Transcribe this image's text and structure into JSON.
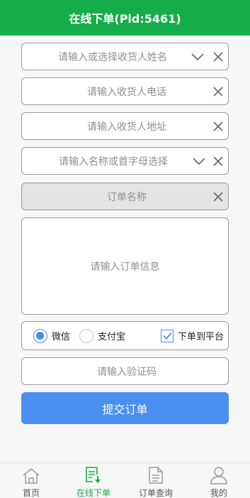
{
  "header": {
    "title": "在线下单(Pid:5461)"
  },
  "form": {
    "recipient_name_placeholder": "请输入或选择收货人姓名",
    "phone_placeholder": "请输入收货人电话",
    "address_placeholder": "请输入收货人地址",
    "product_placeholder": "请输入名称或首字母选择",
    "order_name_placeholder": "订单名称",
    "order_info_placeholder": "请输入订单信息",
    "payment_options": [
      {
        "label": "微信",
        "selected": true
      },
      {
        "label": "支付宝",
        "selected": false
      }
    ],
    "platform_checkbox_label": "下单到平台",
    "platform_checked": true,
    "captcha_placeholder": "请输入验证码",
    "submit_label": "提交订单"
  },
  "tabbar": {
    "items": [
      {
        "label": "首页",
        "icon": "home-icon",
        "active": false
      },
      {
        "label": "在线下单",
        "icon": "order-edit-icon",
        "active": true
      },
      {
        "label": "订单查询",
        "icon": "document-icon",
        "active": false
      },
      {
        "label": "我的",
        "icon": "user-icon",
        "active": false
      }
    ]
  },
  "colors": {
    "brand_green": "#15ad4a",
    "accent_blue": "#4a8ff0"
  }
}
